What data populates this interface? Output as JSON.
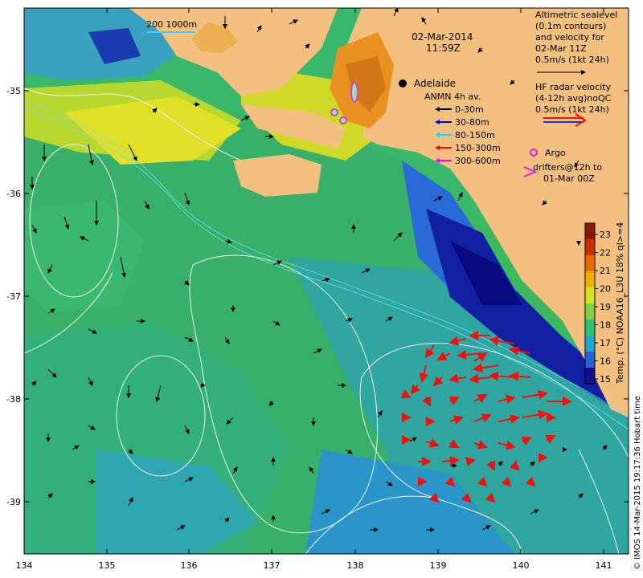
{
  "map": {
    "date": "02-Mar-2014",
    "time": "11:59Z",
    "place_label": "Adelaide",
    "scale_label": "200  1000m",
    "lon_ticks": [
      "134",
      "135",
      "136",
      "137",
      "138",
      "139",
      "140",
      "141"
    ],
    "lat_ticks": [
      "-35",
      "-36",
      "-37",
      "-38",
      "-39"
    ],
    "legend_sealevel": [
      "Altimetric sealevel",
      "(0.1m contours)",
      "and velocity for",
      "02-Mar 11Z",
      "0.5m/s (1kt 24h)"
    ],
    "legend_hf": [
      "HF radar velocity",
      "(4-12h avg)noQC",
      "0.5m/s (1kt 24h)"
    ],
    "legend_anmn": {
      "title": "ANMN 4h av.",
      "items": [
        {
          "label": "0-30m",
          "color": "#000000"
        },
        {
          "label": "30-80m",
          "color": "#0000ff"
        },
        {
          "label": "80-150m",
          "color": "#00e5ff"
        },
        {
          "label": "150-300m",
          "color": "#ff0000"
        },
        {
          "label": "300-600m",
          "color": "#ff00ff"
        }
      ]
    },
    "legend_argo": [
      "Argo",
      "drifters@12h to",
      "01-Mar 00Z"
    ],
    "colorbar": {
      "title": "Temp. (°C) NOAA16_L3U 18% ql>=4",
      "ticks": [
        "23",
        "22",
        "21",
        "20",
        "19",
        "18",
        "17",
        "16",
        "15"
      ],
      "colors": [
        "#8b1a00",
        "#c83000",
        "#e86a00",
        "#f0b000",
        "#d8e020",
        "#80d040",
        "#30c070",
        "#20a8c8",
        "#2860d8",
        "#10108c"
      ]
    },
    "side_caption": "© IMOS 14-Mar-2015 19:17:36 Hobart time"
  }
}
